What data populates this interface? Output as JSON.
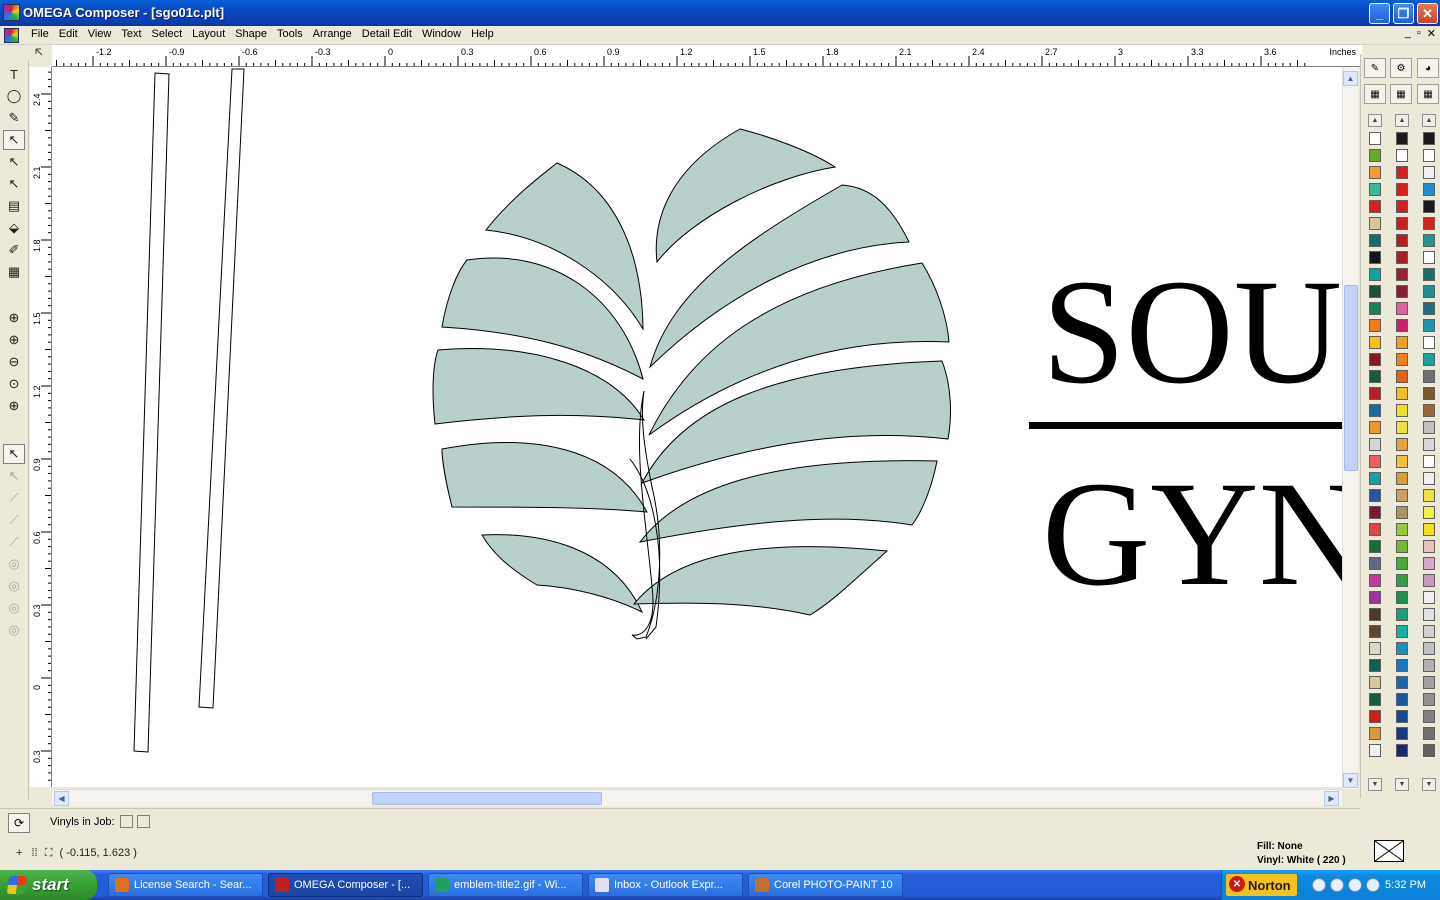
{
  "window": {
    "title": "OMEGA Composer - [sgo01c.plt]"
  },
  "menu": {
    "items": [
      "File",
      "Edit",
      "View",
      "Text",
      "Select",
      "Layout",
      "Shape",
      "Tools",
      "Arrange",
      "Detail Edit",
      "Window",
      "Help"
    ],
    "mdi_controls": [
      "_",
      "▫",
      "✕"
    ]
  },
  "ruler": {
    "top_ticks": [
      "-1.2",
      "-0.9",
      "-0.6",
      "-0.3",
      "0",
      "0.3",
      "0.6",
      "0.9",
      "1.2",
      "1.5",
      "1.8",
      "2.1",
      "2.4",
      "2.7",
      "3",
      "3.3",
      "3.6"
    ],
    "units": "Inches",
    "left_ticks": [
      "2.4",
      "2.1",
      "1.8",
      "1.5",
      "1.2",
      "0.9",
      "0.6",
      "0.3",
      "0",
      "0.3"
    ]
  },
  "canvas": {
    "logo_word_1": "SOU",
    "logo_word_2": "GYN",
    "leaf_fill": "#b8cfcc"
  },
  "toolbox": {
    "tools": [
      "text-tool-icon",
      "shape-tool-icon",
      "pen-tool-icon",
      "node-edit-icon",
      "select-arrow-icon",
      "select-node-icon",
      "measure-icon",
      "fill-bucket-icon",
      "eyedropper-icon",
      "grid-icon",
      "zoom-in-icon",
      "zoom-fit-icon",
      "zoom-out-icon",
      "zoom-page-icon",
      "zoom-all-icon",
      "path-edit-icon",
      "path-tool-2-icon",
      "path-tool-3-icon",
      "path-tool-4-icon",
      "path-tool-5-icon",
      "spiral-1-icon",
      "spiral-2-icon",
      "spiral-3-icon",
      "spiral-4-icon"
    ]
  },
  "status": {
    "vinyls_label": "Vinyls in Job:",
    "coords": "( -0.115, 1.623 )",
    "fill": "Fill: None",
    "vinyl": "Vinyl: White ( 220 )"
  },
  "palette": {
    "col1": [
      "#ffffff",
      "#6aa82a",
      "#f29a3a",
      "#3ab89a",
      "#d81e1e",
      "#d8c8a0",
      "#1a6a70",
      "#141414",
      "#14a0a0",
      "#205038",
      "#18805a",
      "#ee7d16",
      "#f0c414",
      "#881820",
      "#1a5a3a",
      "#b81e2a",
      "#1a6aa0",
      "#e89a2a",
      "#d4d4d4",
      "#e86060",
      "#18a0a0",
      "#3050a0",
      "#7a1a30",
      "#d84848",
      "#1a6a3a",
      "#606888",
      "#c83898",
      "#9a3898",
      "#503828",
      "#604830",
      "#d8d8c8",
      "#106050",
      "#d8c898",
      "#1a5a40",
      "#c81e1e",
      "#d89a3a",
      "#f0f0f0"
    ],
    "col2": [
      "#1a1a1a",
      "#ffffff",
      "#d81e1e",
      "#d81e1e",
      "#d81e1e",
      "#c81e1e",
      "#b81e1e",
      "#a81e2a",
      "#982030",
      "#881e30",
      "#e85ca0",
      "#c8206a",
      "#f0a020",
      "#f08020",
      "#e86010",
      "#f0c020",
      "#f0e020",
      "#f0e040",
      "#e8a040",
      "#f0c040",
      "#d8a030",
      "#c8a060",
      "#a89860",
      "#98c840",
      "#78b830",
      "#48a838",
      "#30a040",
      "#209050",
      "#18a078",
      "#18b0a0",
      "#1890c0",
      "#1878c0",
      "#1868b0",
      "#1a58a0",
      "#1a4890",
      "#1a3880",
      "#1a2870"
    ],
    "col3": [
      "#1a1a1a",
      "#ffffff",
      "#f0f0f0",
      "#1a90d0",
      "#1a1a1a",
      "#d81e1e",
      "#1a9890",
      "#ffffff",
      "#1a7068",
      "#1a9090",
      "#1a7080",
      "#1a98a8",
      "#ffffff",
      "#1aa0a0",
      "#707070",
      "#7a5a28",
      "#986838",
      "#c0c0c0",
      "#d8d8d8",
      "#ffffff",
      "#f0f0f0",
      "#f0e040",
      "#f0f040",
      "#f0e020",
      "#e8c0c0",
      "#d8a8c8",
      "#c898b8",
      "#f0f0f0",
      "#e0e0e0",
      "#d0d0d0",
      "#c0c0c0",
      "#b0b0b0",
      "#a0a0a0",
      "#909090",
      "#808080",
      "#707070",
      "#606060"
    ]
  },
  "taskbar": {
    "start_label": "start",
    "tasks": [
      {
        "label": "License Search - Sear...",
        "color": "#e07020"
      },
      {
        "label": "OMEGA Composer - [...",
        "color": "#c02020"
      },
      {
        "label": "emblem-title2.gif - Wi...",
        "color": "#20a060"
      },
      {
        "label": "Inbox - Outlook Expr...",
        "color": "#e0e0f0"
      },
      {
        "label": "Corel PHOTO-PAINT 10",
        "color": "#c07030"
      }
    ],
    "tray_label": "Norton",
    "clock": "5:32 PM"
  }
}
